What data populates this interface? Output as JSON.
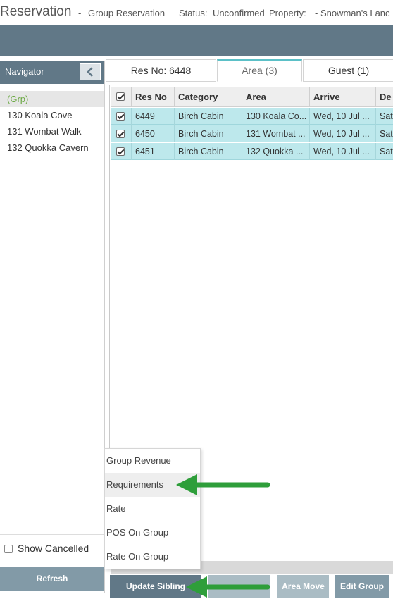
{
  "header": {
    "title": "Reservation",
    "separator": "-",
    "reservation_type": "Group Reservation",
    "status_label": "Status:",
    "status_value": "Unconfirmed",
    "property_label": "Property:",
    "property_value": "- Snowman's Lanc"
  },
  "navigator": {
    "title": "Navigator",
    "collapse_icon": "chevron-left-icon",
    "items": [
      {
        "label": "(Grp)",
        "selected": true
      },
      {
        "label": "130 Koala Cove"
      },
      {
        "label": "131 Wombat Walk"
      },
      {
        "label": "132 Quokka Cavern"
      }
    ],
    "show_cancelled_label": "Show Cancelled",
    "refresh_label": "Refresh"
  },
  "tabs": [
    {
      "label": "Res No: 6448"
    },
    {
      "label": "Area (3)",
      "active": true
    },
    {
      "label": "Guest (1)"
    }
  ],
  "grid": {
    "columns": [
      "Res No",
      "Category",
      "Area",
      "Arrive",
      "De"
    ],
    "rows": [
      {
        "checked": true,
        "res_no": "6449",
        "category": "Birch Cabin",
        "area": "130 Koala Co...",
        "arrive": "Wed, 10 Jul ...",
        "depart": "Sat"
      },
      {
        "checked": true,
        "res_no": "6450",
        "category": "Birch Cabin",
        "area": "131 Wombat ...",
        "arrive": "Wed, 10 Jul ...",
        "depart": "Sat"
      },
      {
        "checked": true,
        "res_no": "6451",
        "category": "Birch Cabin",
        "area": "132 Quokka ...",
        "arrive": "Wed, 10 Jul ...",
        "depart": "Sat"
      }
    ]
  },
  "context_menu": {
    "items": [
      {
        "label": "Group Revenue"
      },
      {
        "label": "Requirements",
        "highlighted": true
      },
      {
        "label": "Rate"
      },
      {
        "label": "POS On Group"
      },
      {
        "label": "Rate On Group"
      }
    ]
  },
  "buttons": {
    "update_sibling": "Update Sibling",
    "area_move": "Area Move",
    "edit_group": "Edit Group"
  },
  "colors": {
    "header_blue": "#617887",
    "row_highlight": "#bde8ec",
    "tab_accent": "#5bc0c7",
    "selected_nav_text": "#6aa842",
    "arrow_green": "#2e9e3a",
    "button_dark": "#617887",
    "button_light": "#aabcc4"
  }
}
